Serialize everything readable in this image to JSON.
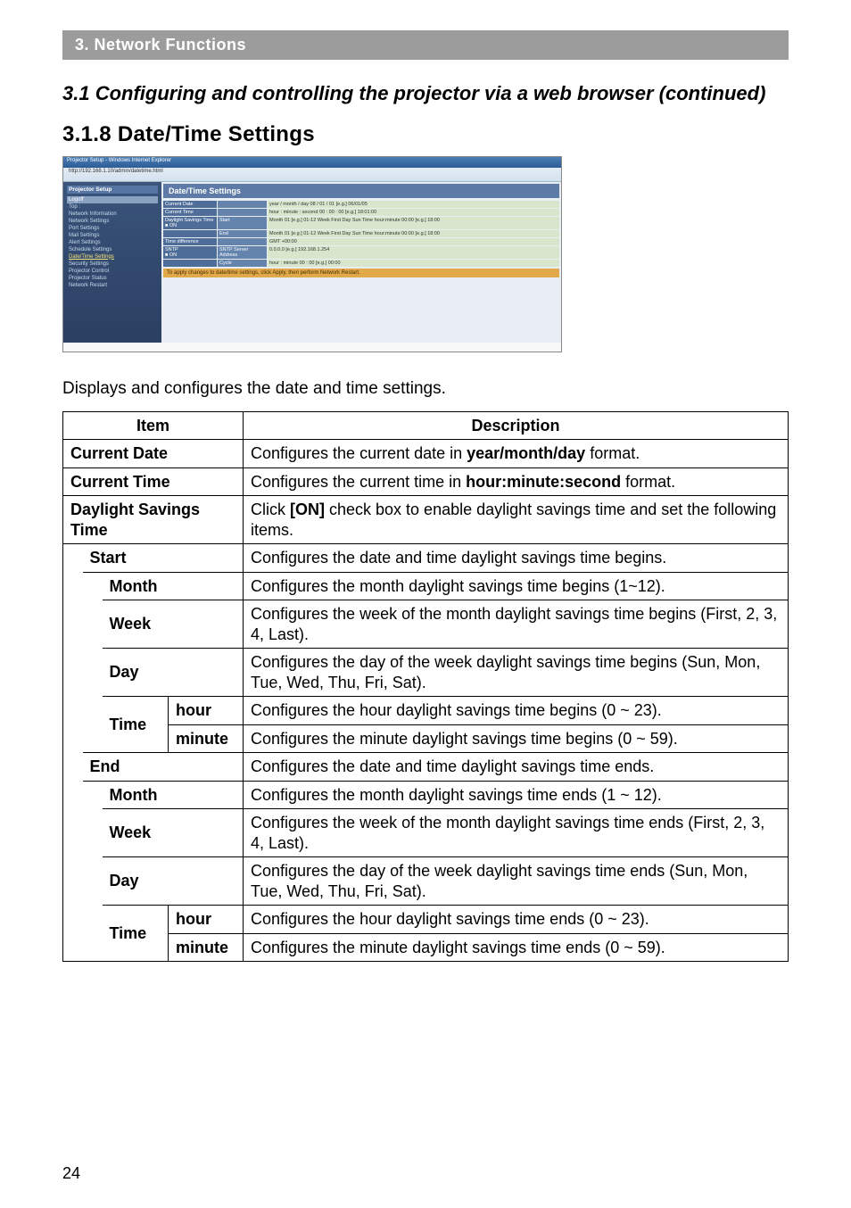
{
  "header": "3. Network Functions",
  "section_title": "3.1 Configuring and controlling the projector via a web browser (continued)",
  "subsection_title": "3.1.8 Date/Time Settings",
  "screenshot": {
    "titlebar": "Projector Setup - Windows Internet Explorer",
    "url": "http://192.168.1.10/admin/datetime.html",
    "side_header": "Projector Setup",
    "logoff": "Logoff",
    "side_items": [
      "Top :",
      "Network Information",
      "Network Settings",
      "Port Settings",
      "Mail Settings",
      "Alert Settings",
      "Schedule Settings",
      "Date/Time Settings",
      "Security Settings",
      "Projector Control",
      "Projector Status",
      "Network Restart"
    ],
    "main_title": "Date/Time Settings",
    "rows_left": [
      "Current Date",
      "Current Time",
      "Daylight Savings Time",
      "",
      "",
      "",
      "Time difference",
      "SNTP",
      ""
    ],
    "rows_mid": [
      "",
      "",
      "Start",
      "",
      "End",
      "",
      "",
      "SNTP Server Address",
      "Cycle"
    ],
    "rows_right": [
      "year / month / day  08 / 01 / 01   [e.g.] 06/01/05",
      "hour : minute : second  00 : 00 : 00   [e.g.] 18:01:00",
      "Month 01   [e.g.] 01-12   Week First   Day Sun   Time hour:minute 00:00 [e.g.] 18:00",
      "",
      "Month 01   [e.g.] 01-12   Week First   Day Sun   Time hour:minute 00:00 [e.g.] 18:00",
      "",
      "GMT +00:00",
      "0.0.0.0   [e.g.] 192.168.1.254",
      "hour : minute  00 : 00   [e.g.] 00:00"
    ],
    "apply": "To apply changes to date/time settings, click Apply, then perform Network Restart.",
    "on_label": "■ ON"
  },
  "intro": "Displays and configures the date and time settings.",
  "table": {
    "head_item": "Item",
    "head_desc": "Description",
    "current_date": {
      "item": "Current Date",
      "desc_pre": "Configures the current date in ",
      "desc_bold": "year/month/day",
      "desc_post": " format."
    },
    "current_time": {
      "item": "Current Time",
      "desc_pre": "Configures the current time in ",
      "desc_bold": "hour:minute:second",
      "desc_post": " format."
    },
    "dst": {
      "item": "Daylight Savings Time",
      "desc_pre": "Click ",
      "desc_bold": "[ON]",
      "desc_post": " check box to enable daylight savings time and set the following items."
    },
    "start": {
      "label": "Start",
      "desc": "Configures the date and time daylight savings time begins.",
      "month": {
        "item": "Month",
        "desc": "Configures the month daylight savings time begins (1~12)."
      },
      "week": {
        "item": "Week",
        "desc": "Configures the week of the month daylight savings time begins (First, 2, 3, 4, Last)."
      },
      "day": {
        "item": "Day",
        "desc": "Configures the day of the week daylight savings time begins (Sun, Mon, Tue, Wed, Thu, Fri, Sat)."
      },
      "time": {
        "item": "Time",
        "hour": {
          "item": "hour",
          "desc": "Configures the hour daylight savings time begins (0 ~ 23)."
        },
        "minute": {
          "item": "minute",
          "desc": "Configures the minute daylight savings time begins (0 ~ 59)."
        }
      }
    },
    "end": {
      "label": "End",
      "desc": "Configures the date and time daylight savings time ends.",
      "month": {
        "item": "Month",
        "desc": "Configures the month daylight savings time ends (1 ~ 12)."
      },
      "week": {
        "item": "Week",
        "desc": "Configures the week of the month daylight savings time ends (First, 2, 3, 4, Last)."
      },
      "day": {
        "item": "Day",
        "desc": "Configures the day of the week daylight savings time ends (Sun, Mon, Tue, Wed, Thu, Fri, Sat)."
      },
      "time": {
        "item": "Time",
        "hour": {
          "item": "hour",
          "desc": "Configures the hour daylight savings time ends (0 ~ 23)."
        },
        "minute": {
          "item": "minute",
          "desc": "Configures the minute daylight savings time ends (0 ~ 59)."
        }
      }
    }
  },
  "page_number": "24"
}
